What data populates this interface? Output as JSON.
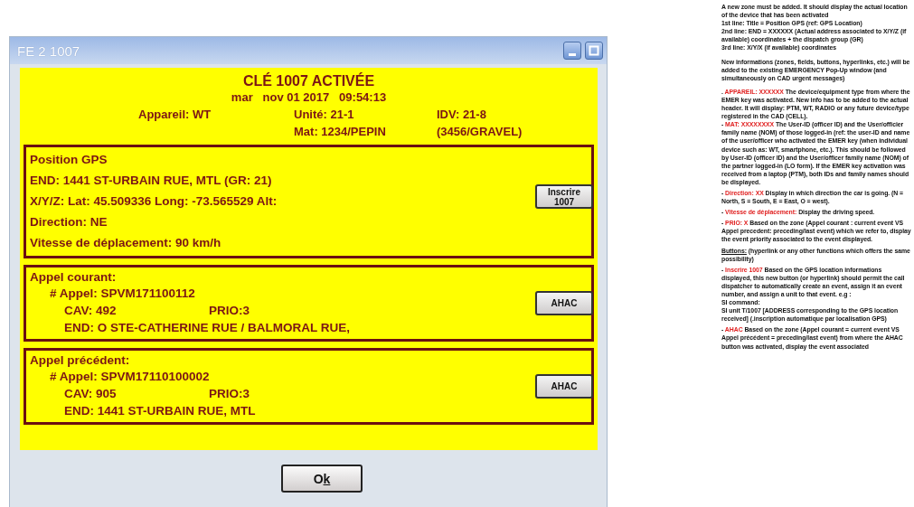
{
  "window": {
    "title": "FE 2 1007"
  },
  "header": {
    "title": "CLÉ 1007 ACTIVÉE",
    "timestamp": "mar   nov 01 2017   09:54:13",
    "device": "Appareil: WT",
    "unit": "Unité: 21-1",
    "idv": "IDV: 21-8",
    "mat": "Mat: 1234/PEPIN",
    "partner": "(3456/GRAVEL)"
  },
  "sections": [
    {
      "kind": "gps",
      "title": "Position GPS",
      "lines": [
        "END: 1441 ST-URBAIN RUE, MTL (GR: 21)",
        "X/Y/Z:  Lat: 45.509336  Long: -73.565529  Alt:",
        "Direction: NE",
        "Vitesse de déplacement:  90 km/h"
      ],
      "button": "Inscrire 1007"
    },
    {
      "kind": "call",
      "title": "Appel courant:",
      "call_number": "# Appel: SPVM171100112",
      "cav": "CAV:  492",
      "prio": "PRIO:3",
      "address": "END: O STE-CATHERINE RUE / BALMORAL RUE,",
      "button": "AHAC"
    },
    {
      "kind": "call",
      "title": "Appel précédent:",
      "call_number": "# Appel: SPVM17110100002",
      "cav": "CAV: 905",
      "prio": "PRIO:3",
      "address": "END: 1441 ST-URBAIN RUE, MTL",
      "button": "AHAC"
    }
  ],
  "ok_button": {
    "parts": [
      {
        "text": "O",
        "underlined": false
      },
      {
        "text": "k",
        "underlined": true
      }
    ]
  },
  "notes": [
    {
      "kind": "block",
      "text": "A new zone must be added.  It should display the actual location of the device that has been activated"
    },
    {
      "kind": "line",
      "text": "1st line: Title = Position GPS (ref: GPS Location)"
    },
    {
      "kind": "line",
      "text": "2nd line: END = XXXXXX (Actual address associated to X/Y/Z (if available) coordinates + the dispatch group (GR)"
    },
    {
      "kind": "line",
      "text": "3rd line: X/Y/X (if available) coordinates"
    },
    {
      "kind": "block",
      "text": "New informations (zones, fields, buttons, hyperlinks, etc.) will be added to the existing EMERGENCY Pop-Up window (and simultaneously on CAD urgent messages)"
    },
    {
      "kind": "block",
      "prefix": ". ",
      "lead": "APPAREIL: XXXXXX",
      "text": "  The device/equipment type from where the EMER key was activated.  New info has to be added to the actual header. It will display: PTM, WT, RADIO or any future device/type registered in the CAD (CELL)."
    },
    {
      "kind": "line",
      "prefix": "- ",
      "lead": "MAT: XXXXXXXX",
      "text": "  The User-ID (officer ID) and the User/officier family name (NOM) of those logged-in (ref: the user-ID and name of the user/officer who activated the EMER key (when individual device such as: WT, smartphone, etc.).  This should be followed by User-ID (officer ID) and the User/officer family name (NOM) of the partner logged-in (LO form).  If the EMER key activation was received from a laptop (PTM), both IDs and family names should be displayed."
    },
    {
      "kind": "item",
      "prefix": "- ",
      "lead": "Direction: XX",
      "text": "  Display in which direction the car is going. (N = North, S = South, E = East, O = west)."
    },
    {
      "kind": "item",
      "prefix": "- ",
      "lead": "Vitesse de déplacement:",
      "text": "  Display the driving speed."
    },
    {
      "kind": "item",
      "prefix": "- ",
      "lead": "PRIO: X",
      "text": "  Based on the zone (Appel courant : current event VS Appel precedent: preceding/last event) which we refer to, display the event priority associated to the event displayed."
    },
    {
      "kind": "heading",
      "lead": "Buttons:",
      "text": "  (hyperlink or any other functions which offers the same possibility)"
    },
    {
      "kind": "item",
      "prefix": "- ",
      "lead": "Inscrire 1007",
      "text": "  Based on the GPS location informations displayed, this new button (or hyperlink) should permit the call dispatcher to automatically create an event, assign it an event number, and assign a unit to that event. e.g :"
    },
    {
      "kind": "line",
      "text": "SI command:"
    },
    {
      "kind": "line",
      "text": "SI unit T/1007 [ADDRESS corresponding to the GPS location received]  (.inscription automatique par localisation GPS)"
    },
    {
      "kind": "item",
      "prefix": "- ",
      "lead": "AHAC",
      "text": "  Based on the zone (Appel courant = current event VS Appel précédent = preceding/last event) from where the AHAC button was activated, display the event associated"
    }
  ]
}
